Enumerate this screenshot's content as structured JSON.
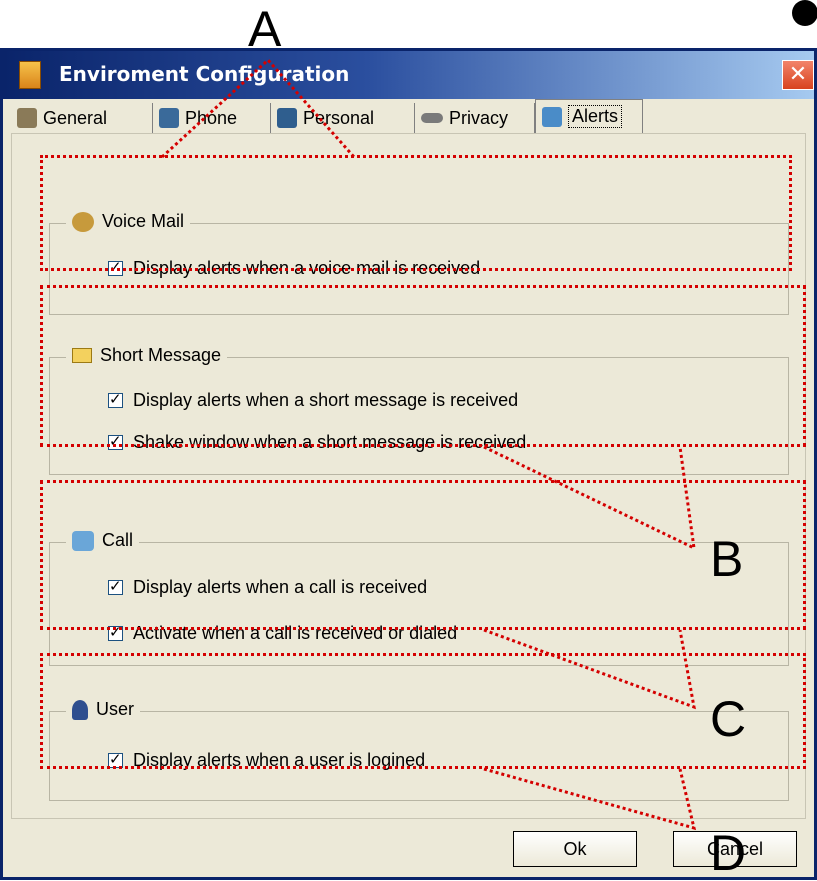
{
  "window": {
    "title": "Enviroment Configuration",
    "close_symbol": "✕"
  },
  "tabs": [
    {
      "label": "General",
      "icon": "general-icon"
    },
    {
      "label": "Phone",
      "icon": "phone-icon"
    },
    {
      "label": "Personal",
      "icon": "personal-icon"
    },
    {
      "label": "Privacy",
      "icon": "privacy-icon"
    },
    {
      "label": "Alerts",
      "icon": "alerts-icon",
      "active": true
    }
  ],
  "groups": {
    "voice_mail": {
      "title": "Voice Mail",
      "options": [
        {
          "label": "Display alerts when a voice mail is received",
          "checked": true
        }
      ]
    },
    "short_message": {
      "title": "Short Message",
      "options": [
        {
          "label": "Display alerts when a short message is received",
          "checked": true
        },
        {
          "label": "Shake window when a short message is received",
          "checked": true
        }
      ]
    },
    "call": {
      "title": "Call",
      "options": [
        {
          "label": "Display alerts when a call is received",
          "checked": true
        },
        {
          "label": "Activate when a call is received or dialed",
          "checked": true
        }
      ]
    },
    "user": {
      "title": "User",
      "options": [
        {
          "label": "Display alerts when a user is logined",
          "checked": true
        }
      ]
    }
  },
  "buttons": {
    "ok": "Ok",
    "cancel": "Cancel"
  },
  "annotations": {
    "a": "A",
    "b": "B",
    "c": "C",
    "d": "D",
    "color": "#d40000"
  }
}
